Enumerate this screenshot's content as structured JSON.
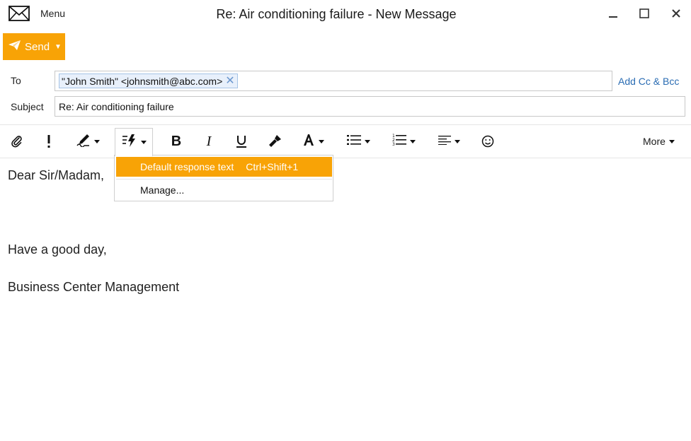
{
  "window": {
    "title": "Re: Air conditioning failure - New Message",
    "menu_label": "Menu",
    "icons": [
      "mail-icon",
      "minimize-icon",
      "maximize-icon",
      "close-icon"
    ]
  },
  "actions": {
    "send_label": "Send",
    "accent_color": "#f8a306"
  },
  "fields": {
    "to_label": "To",
    "recipient": "\"John Smith\" <johnsmith@abc.com>",
    "add_cc_bcc": "Add Cc & Bcc",
    "subject_label": "Subject",
    "subject_value": "Re: Air conditioning failure"
  },
  "toolbar": {
    "icons": [
      "attach-icon",
      "importance-icon",
      "signature-icon",
      "quick-text-icon",
      "bold-icon",
      "italic-icon",
      "underline-icon",
      "format-painter-icon",
      "font-color-icon",
      "bullet-list-icon",
      "numbered-list-icon",
      "align-icon",
      "emoji-icon"
    ],
    "more_label": "More"
  },
  "quick_text_menu": {
    "items": [
      {
        "label": "Default response text",
        "shortcut": "Ctrl+Shift+1"
      },
      {
        "label": "Manage..."
      }
    ]
  },
  "message_body": {
    "lines": [
      "Dear Sir/Madam,",
      "Have a good day,",
      "Business Center Management"
    ]
  }
}
